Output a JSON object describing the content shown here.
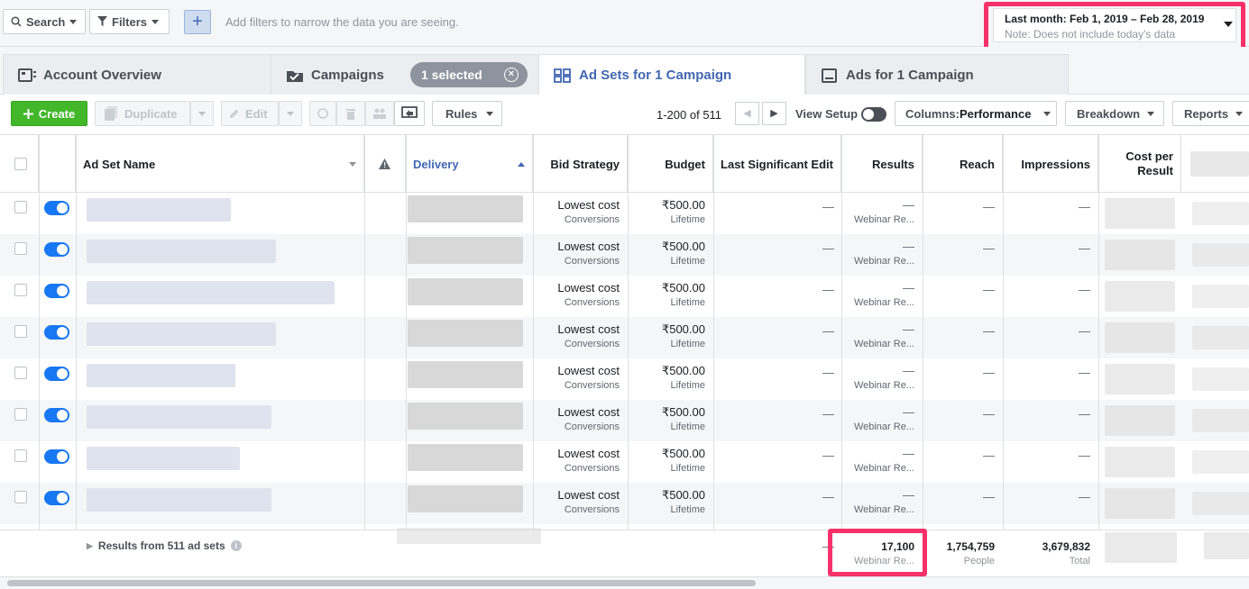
{
  "filterbar": {
    "search_label": "Search",
    "filters_label": "Filters",
    "add_label": "+",
    "hint": "Add filters to narrow the data you are seeing.",
    "date_range": "Last month: Feb 1, 2019 – Feb 28, 2019",
    "date_note": "Note: Does not include today's data"
  },
  "tabs": {
    "account_overview": "Account Overview",
    "campaigns": "Campaigns",
    "selected_pill": "1 selected",
    "ad_sets": "Ad Sets for 1 Campaign",
    "ads": "Ads for 1 Campaign"
  },
  "toolbar": {
    "create": "Create",
    "duplicate": "Duplicate",
    "edit": "Edit",
    "rules": "Rules",
    "pager": "1-200 of 511",
    "view_setup": "View Setup",
    "columns_prefix": "Columns: ",
    "columns_value": "Performance",
    "breakdown": "Breakdown",
    "reports": "Reports"
  },
  "table": {
    "headers": {
      "name": "Ad Set Name",
      "delivery": "Delivery",
      "bid_strategy": "Bid Strategy",
      "budget": "Budget",
      "last_edit": "Last Significant Edit",
      "results": "Results",
      "reach": "Reach",
      "impressions": "Impressions",
      "cost_per_result_1": "Cost per",
      "cost_per_result_2": "Result"
    },
    "rows": [
      {
        "bid": "Lowest cost",
        "bid_sub": "Conversions",
        "budget": "₹500.00",
        "budget_sub": "Lifetime",
        "last_edit": "—",
        "results": "—",
        "results_sub": "Webinar Re...",
        "reach": "—",
        "impressions": "—"
      },
      {
        "bid": "Lowest cost",
        "bid_sub": "Conversions",
        "budget": "₹500.00",
        "budget_sub": "Lifetime",
        "last_edit": "—",
        "results": "—",
        "results_sub": "Webinar Re...",
        "reach": "—",
        "impressions": "—"
      },
      {
        "bid": "Lowest cost",
        "bid_sub": "Conversions",
        "budget": "₹500.00",
        "budget_sub": "Lifetime",
        "last_edit": "—",
        "results": "—",
        "results_sub": "Webinar Re...",
        "reach": "—",
        "impressions": "—"
      },
      {
        "bid": "Lowest cost",
        "bid_sub": "Conversions",
        "budget": "₹500.00",
        "budget_sub": "Lifetime",
        "last_edit": "—",
        "results": "—",
        "results_sub": "Webinar Re...",
        "reach": "—",
        "impressions": "—"
      },
      {
        "bid": "Lowest cost",
        "bid_sub": "Conversions",
        "budget": "₹500.00",
        "budget_sub": "Lifetime",
        "last_edit": "—",
        "results": "—",
        "results_sub": "Webinar Re...",
        "reach": "—",
        "impressions": "—"
      },
      {
        "bid": "Lowest cost",
        "bid_sub": "Conversions",
        "budget": "₹500.00",
        "budget_sub": "Lifetime",
        "last_edit": "—",
        "results": "—",
        "results_sub": "Webinar Re...",
        "reach": "—",
        "impressions": "—"
      },
      {
        "bid": "Lowest cost",
        "bid_sub": "Conversions",
        "budget": "₹500.00",
        "budget_sub": "Lifetime",
        "last_edit": "—",
        "results": "—",
        "results_sub": "Webinar Re...",
        "reach": "—",
        "impressions": "—"
      },
      {
        "bid": "Lowest cost",
        "bid_sub": "Conversions",
        "budget": "₹500.00",
        "budget_sub": "Lifetime",
        "last_edit": "—",
        "results": "—",
        "results_sub": "Webinar Re...",
        "reach": "—",
        "impressions": "—"
      }
    ],
    "footer": {
      "title": "Results from 511 ad sets",
      "last_edit": "—",
      "results": "17,100",
      "results_sub": "Webinar Re...",
      "reach": "1,754,759",
      "reach_sub": "People",
      "impressions": "3,679,832",
      "impressions_sub": "Total"
    }
  },
  "colors": {
    "accent": "#4267b2",
    "create_green": "#42b72a",
    "highlight": "#f7316a",
    "toggle_on": "#1877f2"
  }
}
